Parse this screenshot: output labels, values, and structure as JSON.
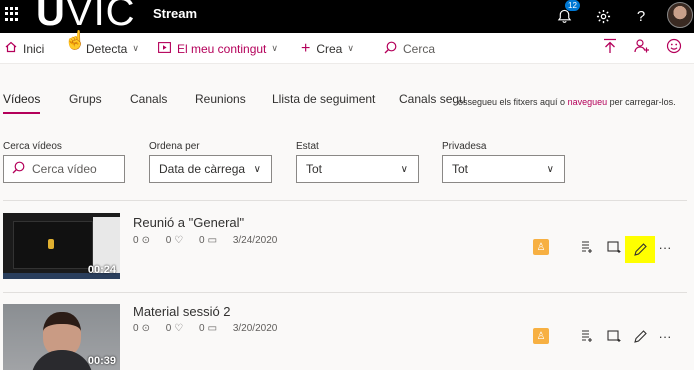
{
  "topbar": {
    "logo_letter": "U",
    "logo_rest": "VIC",
    "app_name": "Stream",
    "notification_count": "12",
    "settings_icon": "gear-icon",
    "help_label": "?",
    "bell_icon": "bell-icon"
  },
  "nav": {
    "home": "Inici",
    "discover": "Detecta",
    "my_content": "El meu contingut",
    "create": "Crea",
    "search": "Cerca"
  },
  "tabs": [
    {
      "label": "Vídeos"
    },
    {
      "label": "Grups"
    },
    {
      "label": "Canals"
    },
    {
      "label": "Reunions"
    },
    {
      "label": "Llista de seguiment"
    },
    {
      "label": "Canals segu"
    }
  ],
  "drop_message": {
    "before": "ossegueu els fitxers aquí o ",
    "link": "navegueu",
    "after": " per carregar-los."
  },
  "filters": {
    "search_label": "Cerca vídeos",
    "search_placeholder": "Cerca vídeo",
    "sort_label": "Ordena per",
    "sort_value": "Data de càrrega",
    "state_label": "Estat",
    "state_value": "Tot",
    "privacy_label": "Privadesa",
    "privacy_value": "Tot"
  },
  "videos": [
    {
      "title": "Reunió a \"General\"",
      "views": "0",
      "likes": "0",
      "comments": "0",
      "date": "3/24/2020",
      "duration": "00:24"
    },
    {
      "title": "Material sessió 2",
      "views": "0",
      "likes": "0",
      "comments": "0",
      "date": "3/20/2020",
      "duration": "00:39"
    }
  ],
  "colors": {
    "accent": "#b4005a",
    "highlight": "#ffff00",
    "permission": "#f7b042"
  }
}
